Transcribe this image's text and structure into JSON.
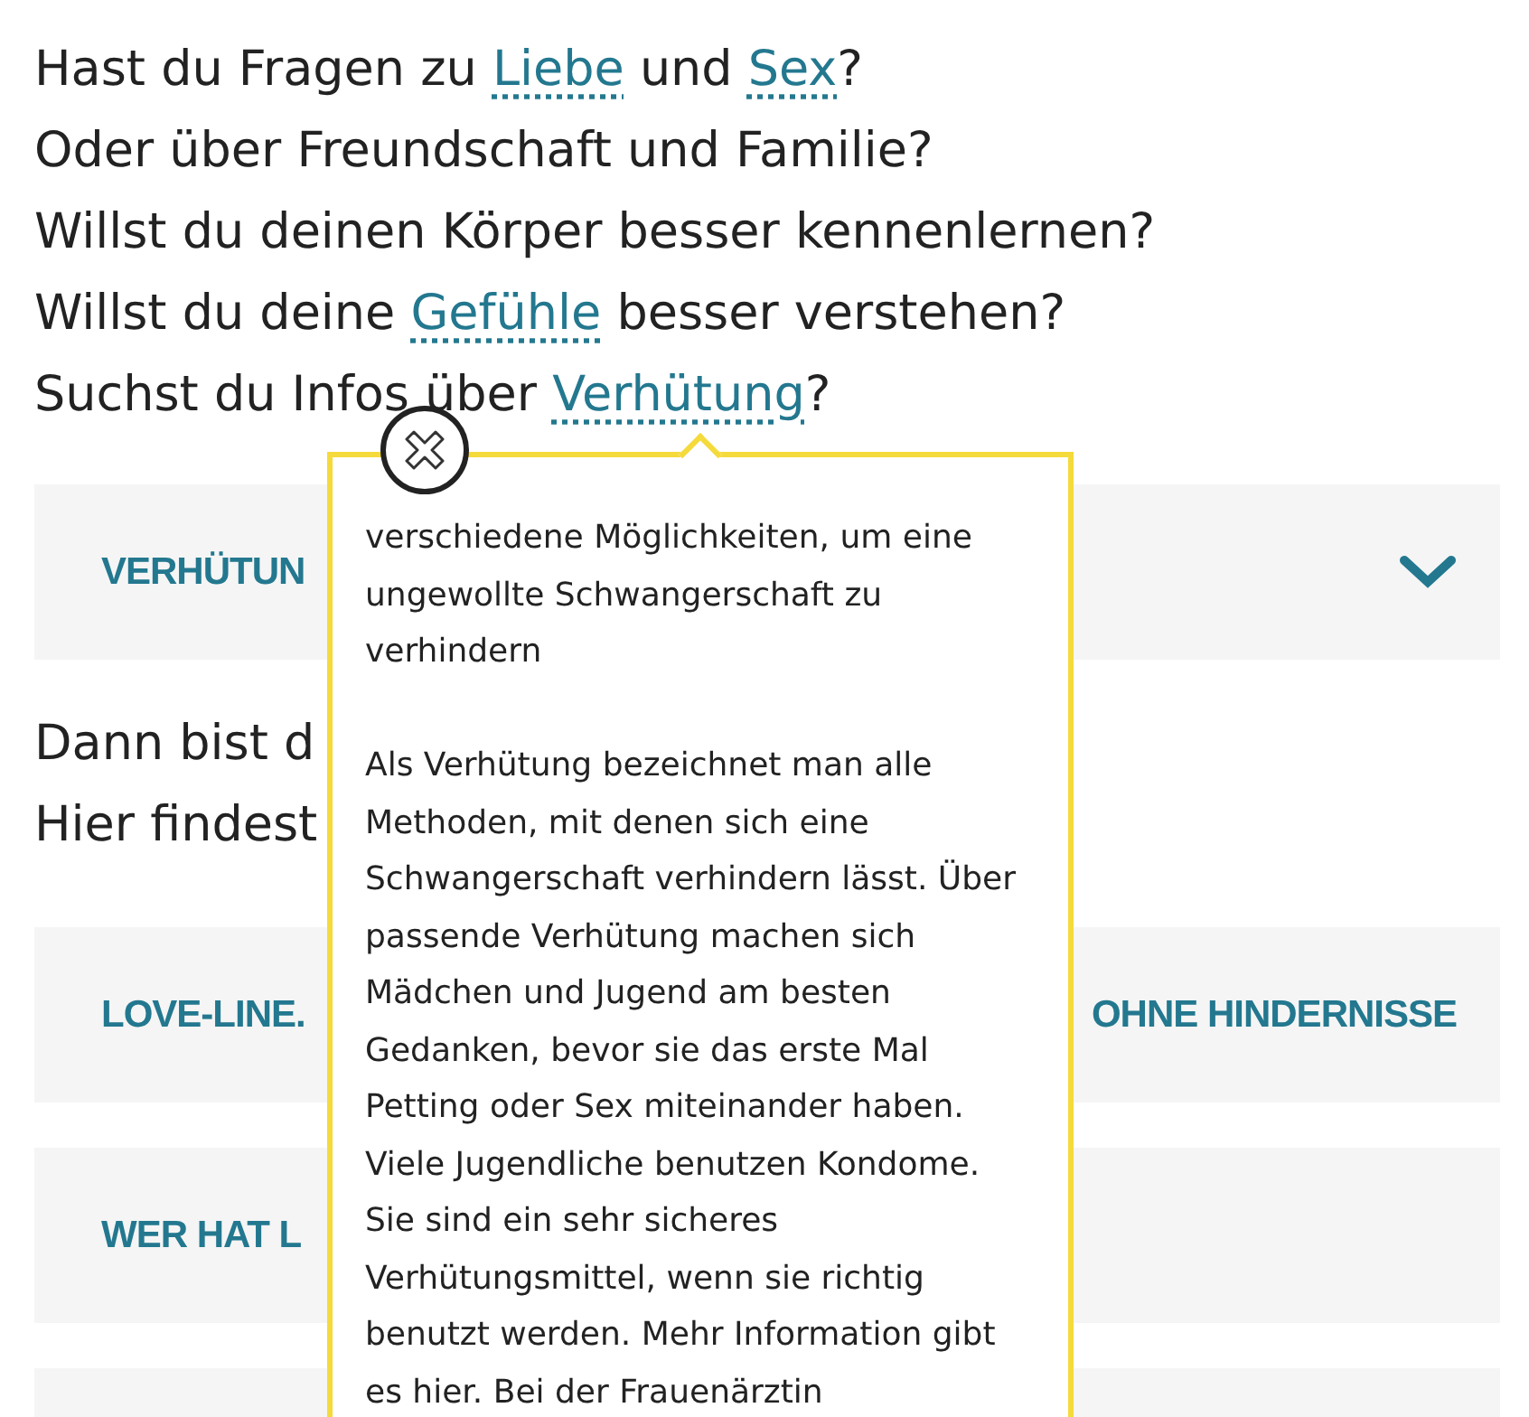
{
  "intro_lines": [
    [
      {
        "kind": "text",
        "text": "Hast du Fragen zu "
      },
      {
        "kind": "link",
        "text": "Liebe"
      },
      {
        "kind": "text",
        "text": " und "
      },
      {
        "kind": "link",
        "text": "Sex"
      },
      {
        "kind": "text",
        "text": "?"
      }
    ],
    [
      {
        "kind": "text",
        "text": "Oder über Freundschaft und Familie?"
      }
    ],
    [
      {
        "kind": "text",
        "text": "Willst du deinen Körper besser kennenlernen?"
      }
    ],
    [
      {
        "kind": "text",
        "text": "Willst du deine "
      },
      {
        "kind": "link",
        "text": "Gefühle"
      },
      {
        "kind": "text",
        "text": " besser verstehen?"
      }
    ],
    [
      {
        "kind": "text",
        "text": "Suchst du Infos über "
      },
      {
        "kind": "link",
        "text": "Verhütung"
      },
      {
        "kind": "text",
        "text": "?"
      }
    ]
  ],
  "accordion_top": {
    "title": "VERHÜTUN",
    "expanded": false
  },
  "middle_lines": [
    "Dann bist d",
    "Hier findest"
  ],
  "accordion": [
    {
      "title": "LOVE-LINE.",
      "title_right": "OHNE HINDERNISSE"
    },
    {
      "title": "WER HAT L"
    }
  ],
  "tooltip": {
    "paragraphs": [
      "verschiedene Möglichkeiten, um eine ungewollte Schwangerschaft zu verhindern",
      "Als Verhütung bezeichnet man alle Methoden, mit denen sich eine Schwangerschaft verhindern lässt. Über passende Verhütung machen sich Mädchen und Jugend am besten Gedanken, bevor sie das erste Mal Petting oder Sex miteinander haben. Viele Jugendliche benutzen Kondome. Sie sind ein sehr sicheres Verhütungsmittel, wenn sie richtig benutzt werden. Mehr Information gibt es hier. Bei der Frauenärztin"
    ]
  }
}
